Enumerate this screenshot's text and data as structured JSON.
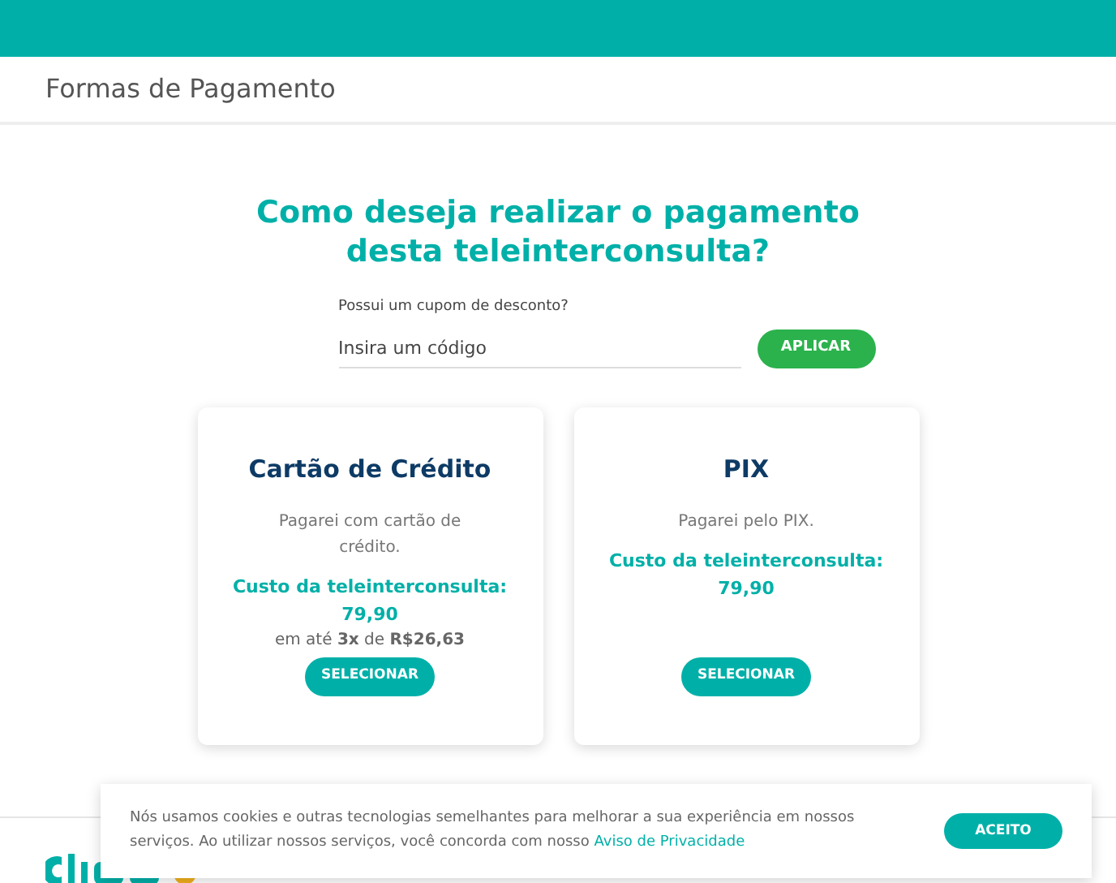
{
  "header": {
    "title": "Formas de Pagamento"
  },
  "heading": "Como deseja realizar o pagamento desta teleinterconsulta?",
  "coupon": {
    "label": "Possui um cupom de desconto?",
    "placeholder": "Insira um código",
    "button": "APLICAR"
  },
  "options": [
    {
      "title": "Cartão de Crédito",
      "description": "Pagarei com cartão de crédito.",
      "cost_label": "Custo da teleinterconsulta:",
      "cost": "79,90",
      "installments": "em até **3x** de **R$26,63**",
      "button": "SELECIONAR"
    },
    {
      "title": "PIX",
      "description": "Pagarei pelo PIX.",
      "cost_label": "Custo da teleinterconsulta:",
      "cost": "79,90",
      "button": "SELECIONAR"
    }
  ],
  "cookie_banner": {
    "text": "Nós usamos cookies e outras tecnologias semelhantes para melhorar a sua experiência em nossos serviços. Ao utilizar nossos serviços, você concorda com nosso",
    "link": "Aviso de Privacidade",
    "button": "ACEITO"
  }
}
